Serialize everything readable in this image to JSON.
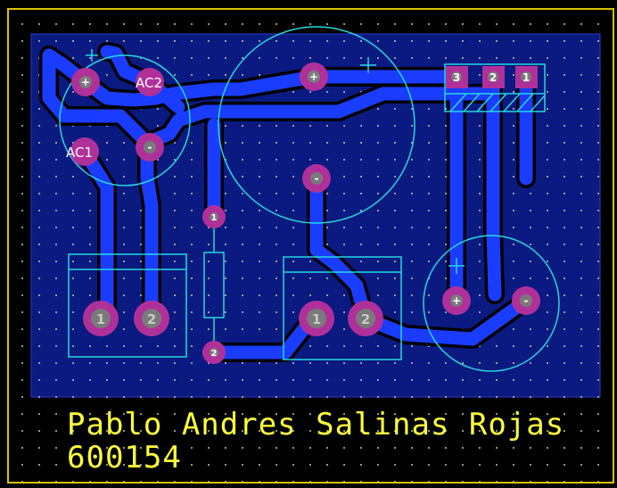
{
  "board": {
    "colors": {
      "background": "#000000",
      "board_outline": "#d8c000",
      "grid_dot": "#c8c8a0",
      "copper_area": "#0a1a80",
      "track": "#1a3cff",
      "track_outline": "#000000",
      "pad": "#b0309a",
      "pad_hole": "#7a7a7a",
      "silkscreen_cyan": "#27d8e0",
      "silkscreen_text": "#ffffff",
      "author_text": "#ffff3a"
    }
  },
  "components": {
    "bridge": {
      "pad_plus": "+",
      "pad_ac2": "AC2",
      "pad_ac1": "AC1",
      "pad_minus": "-",
      "polarity_mark": "+"
    },
    "big_capacitor": {
      "pad_plus": "+",
      "pad_minus": "-",
      "polarity_mark": "+"
    },
    "regulator": {
      "pin3": "3",
      "pin2": "2",
      "pin1": "1"
    },
    "resistor": {
      "pin1": "1",
      "pin2": "2"
    },
    "connector_left": {
      "pin1": "1",
      "pin2": "2"
    },
    "connector_mid": {
      "pin1": "1",
      "pin2": "2"
    },
    "small_capacitor": {
      "pad_plus": "+",
      "pad_minus": "-",
      "polarity_mark": "+"
    }
  },
  "author": {
    "name": "Pablo Andres Salinas Rojas",
    "id": "600154"
  }
}
